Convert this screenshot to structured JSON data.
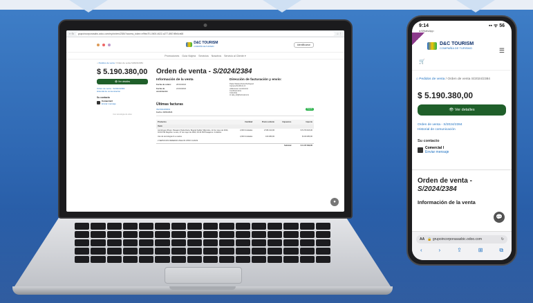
{
  "laptop": {
    "browser": {
      "nav_icons": "‹ › ↻",
      "address": "grupoincorporasabs.odoo.com/my/orders/2384?access_token=e9fea7f1-0600-4622-a277-8f87d9b6cb68",
      "toolbar_icons": "☆ ⋮"
    },
    "header": {
      "brand": "D&C TOURISM",
      "brand_sub": "COMPAÑÍA DE TURISMO",
      "cert_button": "Identificarse"
    },
    "nav": [
      "Promociones",
      "Guía Viajera",
      "Servicios",
      "Nosotros",
      "Servicio al Cliente ▾"
    ],
    "breadcrumb": {
      "home": "⌂",
      "link": "Pedidos de venta",
      "sep": "/",
      "current": "Orden de venta S/2024/2384"
    },
    "summary": {
      "price": "$ 5.190.380,00",
      "details_button": "👁 Ver detalles",
      "link1": "Orden de venta - S/2024/2384",
      "link2": "Historial de comunicación",
      "contact_heading": "Su contacto",
      "contact_name": "Comercial I",
      "contact_action": "Enviar mensaje",
      "powered": "Con tecnología de odoo"
    },
    "order": {
      "title_prefix": "Orden de venta - ",
      "title_id": "S/2024/2384",
      "info_heading": "Información de la venta",
      "date_label": "Fecha de orden:",
      "date_value": "20/01/2024",
      "expiry_label": "Fecha de vencimiento:",
      "expiry_value": "21/01/2024",
      "billing_heading": "Dirección de facturación y envío:",
      "billing_lines": [
        "Paola Tatiana Daza Rodríguez",
        "Carrera 8A #8-43, D",
        "valle/nuevo condominio",
        "Cundinamarca",
        "Colombia",
        "✉ tata_22@hotmail.com"
      ],
      "invoices_heading": "Últimas facturas",
      "invoice_id": "INV/2024/00001",
      "invoice_date": "Fecha: 20/01/2024",
      "invoice_badge": "Pagada"
    },
    "table": {
      "headers": [
        "Productos",
        "Cantidad",
        "Precio unitario",
        "Impuestos",
        "Importe"
      ],
      "section": "Vuelo",
      "rows": [
        [
          "Aerolíneas Wingo: Pasajero Paula Daza. Bogotá Salida: Miércoles, 22 de mayo de 2024, 04:33 PM Regreso: Lunes, 27 de mayo de 2024, 09:43 PM Pasajeros: 2 Adultos",
          "2,000 Unidades",
          "2.535.313,00",
          "",
          "$ 5.070.626,00"
        ],
        [
          "Uso de tecnología dn a vuelos",
          "2,000 Unidades",
          "100.380,00",
          "",
          "$ 100.380,00"
        ],
        [
          "2 SERVICIOS RESERVA VUELOS OTRO CASOS",
          "",
          "",
          "",
          ""
        ]
      ],
      "subtotal_label": "Subtotal",
      "subtotal_value": "$ 4.417.399,00"
    },
    "chat_icon": "●"
  },
  "phone": {
    "time": "9:14",
    "back_source": "◂ WhatsApp",
    "status_icons": "▪▪ ᯤ 56",
    "brand": "D&C TOURISM",
    "brand_sub": "COMPAÑÍA DE TURISMO",
    "cart": "🛒",
    "burger": "☰",
    "breadcrumb": {
      "home": "⌂",
      "link": "Pedidos de venta",
      "current": " / Orden de venta S/2024/2384"
    },
    "price": "$ 5.190.380,00",
    "details_button": "👁 Ver detalles",
    "link1": "Orden de venta - S/2024/2384",
    "link2": "Historial de comunicación",
    "contact_heading": "Su contacto",
    "contact_name": "Comercial I",
    "contact_action": "Enviar mensaje",
    "order_title_prefix": "Orden de venta -",
    "order_title_id": "S/2024/2384",
    "info_heading": "Información de la venta",
    "chat_icon": "💬",
    "safari": {
      "aa": "AA",
      "url": "🔒 grupoincorporasasbic.odoo.com",
      "reload": "↻",
      "nav": [
        "‹",
        "›",
        "⇪",
        "⊞",
        "⧉"
      ]
    }
  }
}
